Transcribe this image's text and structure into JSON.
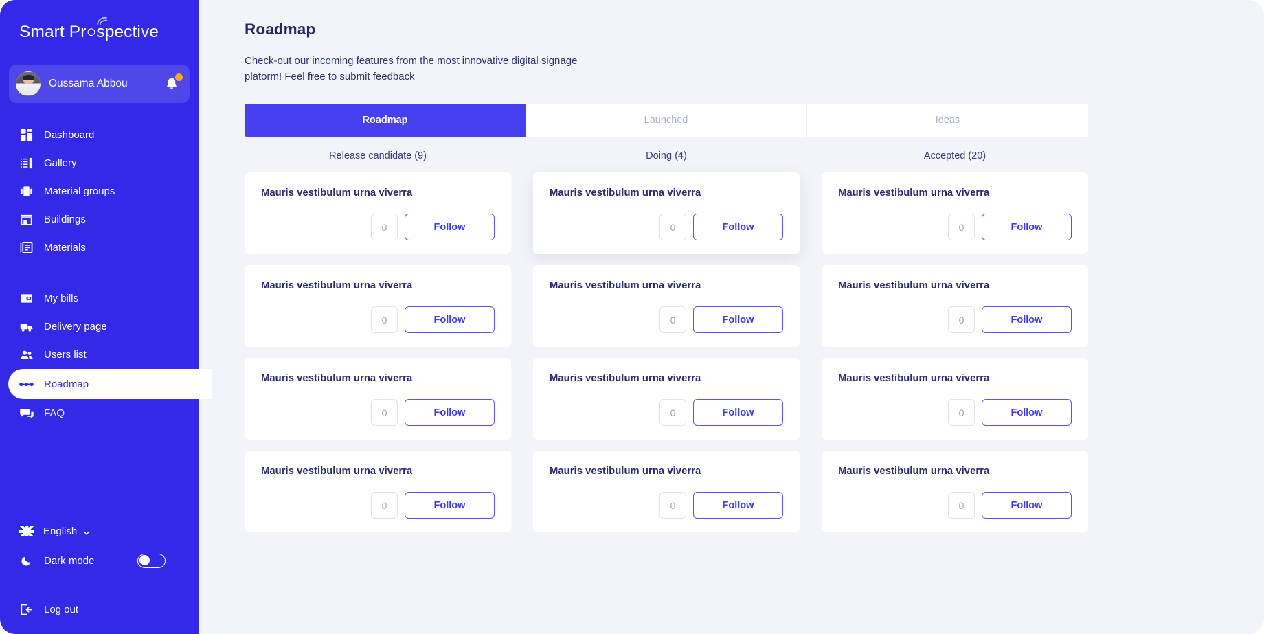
{
  "brand": {
    "name_part1": "Smart Pr",
    "name_part2": "spective",
    "logo_full": "Smart Prospective"
  },
  "profile": {
    "name": "Oussama Abbou",
    "avatar_icon": "user-avatar",
    "bell_icon": "bell-icon",
    "has_notification": true
  },
  "sidebar": {
    "items": [
      {
        "label": "Dashboard",
        "icon": "dashboard-icon",
        "active": false
      },
      {
        "label": "Gallery",
        "icon": "gallery-icon",
        "active": false
      },
      {
        "label": "Material groups",
        "icon": "material-groups-icon",
        "active": false
      },
      {
        "label": "Buildings",
        "icon": "buildings-icon",
        "active": false
      },
      {
        "label": "Materials",
        "icon": "materials-icon",
        "active": false
      },
      {
        "label": "My bills",
        "icon": "bills-icon",
        "active": false
      },
      {
        "label": "Delivery page",
        "icon": "delivery-truck-icon",
        "active": false
      },
      {
        "label": "Users list",
        "icon": "users-icon",
        "active": false
      },
      {
        "label": "Roadmap",
        "icon": "roadmap-icon",
        "active": true
      },
      {
        "label": "FAQ",
        "icon": "faq-chat-icon",
        "active": false
      }
    ],
    "language": {
      "label": "English",
      "flag": "uk-flag-icon",
      "chevron": "chevron-down-icon"
    },
    "dark_mode": {
      "label": "Dark mode",
      "icon": "moon-icon",
      "enabled": false
    },
    "logout": {
      "label": "Log out",
      "icon": "logout-icon"
    }
  },
  "header": {
    "title": "Roadmap",
    "description": "Check-out our incoming features from the most innovative digital signage\nplatorm!  Feel free to submit feedback"
  },
  "tabs": [
    {
      "label": "Roadmap",
      "active": true
    },
    {
      "label": "Launched",
      "active": false
    },
    {
      "label": "Ideas",
      "active": false
    }
  ],
  "columns": [
    {
      "heading": "Release candidate (9)",
      "cards": [
        {
          "title": "Mauris vestibulum urna viverra",
          "count": "0",
          "follow_label": "Follow",
          "elevated": false
        },
        {
          "title": "Mauris vestibulum urna viverra",
          "count": "0",
          "follow_label": "Follow",
          "elevated": false
        },
        {
          "title": "Mauris vestibulum urna viverra",
          "count": "0",
          "follow_label": "Follow",
          "elevated": false
        },
        {
          "title": "Mauris vestibulum urna viverra",
          "count": "0",
          "follow_label": "Follow",
          "elevated": false
        }
      ]
    },
    {
      "heading": "Doing (4)",
      "cards": [
        {
          "title": "Mauris vestibulum urna viverra",
          "count": "0",
          "follow_label": "Follow",
          "elevated": true
        },
        {
          "title": "Mauris vestibulum urna viverra",
          "count": "0",
          "follow_label": "Follow",
          "elevated": false
        },
        {
          "title": "Mauris vestibulum urna viverra",
          "count": "0",
          "follow_label": "Follow",
          "elevated": false
        },
        {
          "title": "Mauris vestibulum urna viverra",
          "count": "0",
          "follow_label": "Follow",
          "elevated": false
        }
      ]
    },
    {
      "heading": "Accepted (20)",
      "cards": [
        {
          "title": "Mauris vestibulum urna viverra",
          "count": "0",
          "follow_label": "Follow",
          "elevated": false
        },
        {
          "title": "Mauris vestibulum urna viverra",
          "count": "0",
          "follow_label": "Follow",
          "elevated": false
        },
        {
          "title": "Mauris vestibulum urna viverra",
          "count": "0",
          "follow_label": "Follow",
          "elevated": false
        },
        {
          "title": "Mauris vestibulum urna viverra",
          "count": "0",
          "follow_label": "Follow",
          "elevated": false
        }
      ]
    }
  ],
  "colors": {
    "sidebar_blue": "#3329e6",
    "tab_active_blue": "#4640f0",
    "page_bg": "#f2f4f9",
    "card_title": "#2b2d6b",
    "follow_border": "#5b52f0",
    "badge_orange": "#f9a825"
  }
}
